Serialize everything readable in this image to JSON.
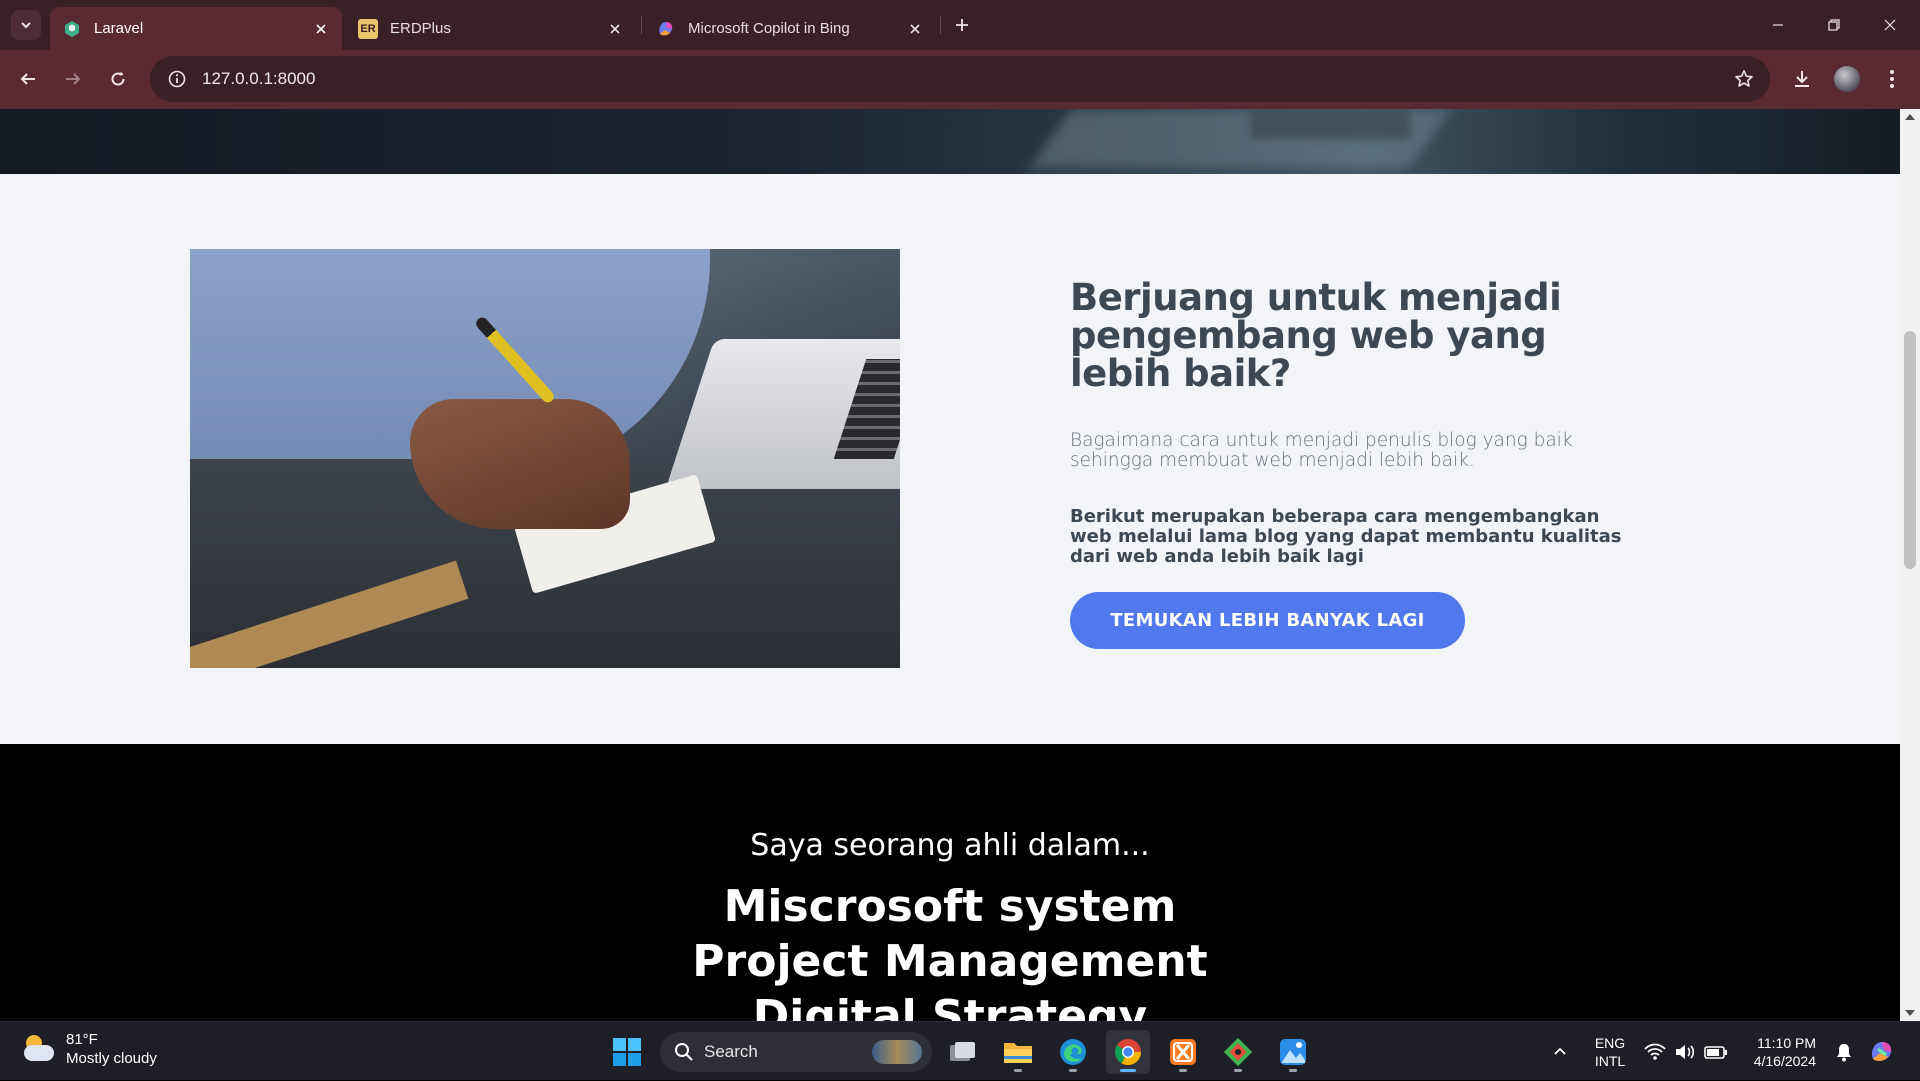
{
  "browser": {
    "tabs": [
      {
        "label": "Laravel",
        "active": true,
        "favicon": "laravel-favicon"
      },
      {
        "label": "ERDPlus",
        "active": false,
        "favicon": "erdplus-favicon",
        "favicon_text": "ER"
      },
      {
        "label": "Microsoft Copilot in Bing",
        "active": false,
        "favicon": "copilot-favicon"
      }
    ],
    "url": "127.0.0.1:8000"
  },
  "page": {
    "about": {
      "title": "Berjuang untuk menjadi pengembang web yang lebih baik?",
      "description": "Bagaimana cara untuk menjadi penulis blog yang baik sehingga membuat web menjadi lebih baik.",
      "highlight": "Berikut merupakan beberapa cara mengembangkan web melalui lama blog yang dapat membantu kualitas dari web anda lebih baik lagi",
      "button_label": "TEMUKAN LEBIH BANYAK LAGI",
      "button_color": "#5079ee"
    },
    "skills": {
      "subtitle": "Saya seorang ahli dalam...",
      "items": [
        "Miscrosoft system",
        "Project Management",
        "Digital Strategy"
      ]
    }
  },
  "taskbar": {
    "weather": {
      "temp": "81°F",
      "condition": "Mostly cloudy"
    },
    "search_placeholder": "Search",
    "language": {
      "line1": "ENG",
      "line2": "INTL"
    },
    "clock": {
      "time": "11:10 PM",
      "date": "4/16/2024"
    },
    "pinned": [
      "task-view-icon",
      "file-explorer-icon",
      "edge-icon",
      "chrome-icon",
      "xampp-icon",
      "git-icon",
      "photos-icon"
    ]
  },
  "colors": {
    "chrome_dark": "#3b1f27",
    "chrome_toolbar": "#5a2a33",
    "page_bg": "#f2f4f7",
    "heading": "#3e4853"
  }
}
